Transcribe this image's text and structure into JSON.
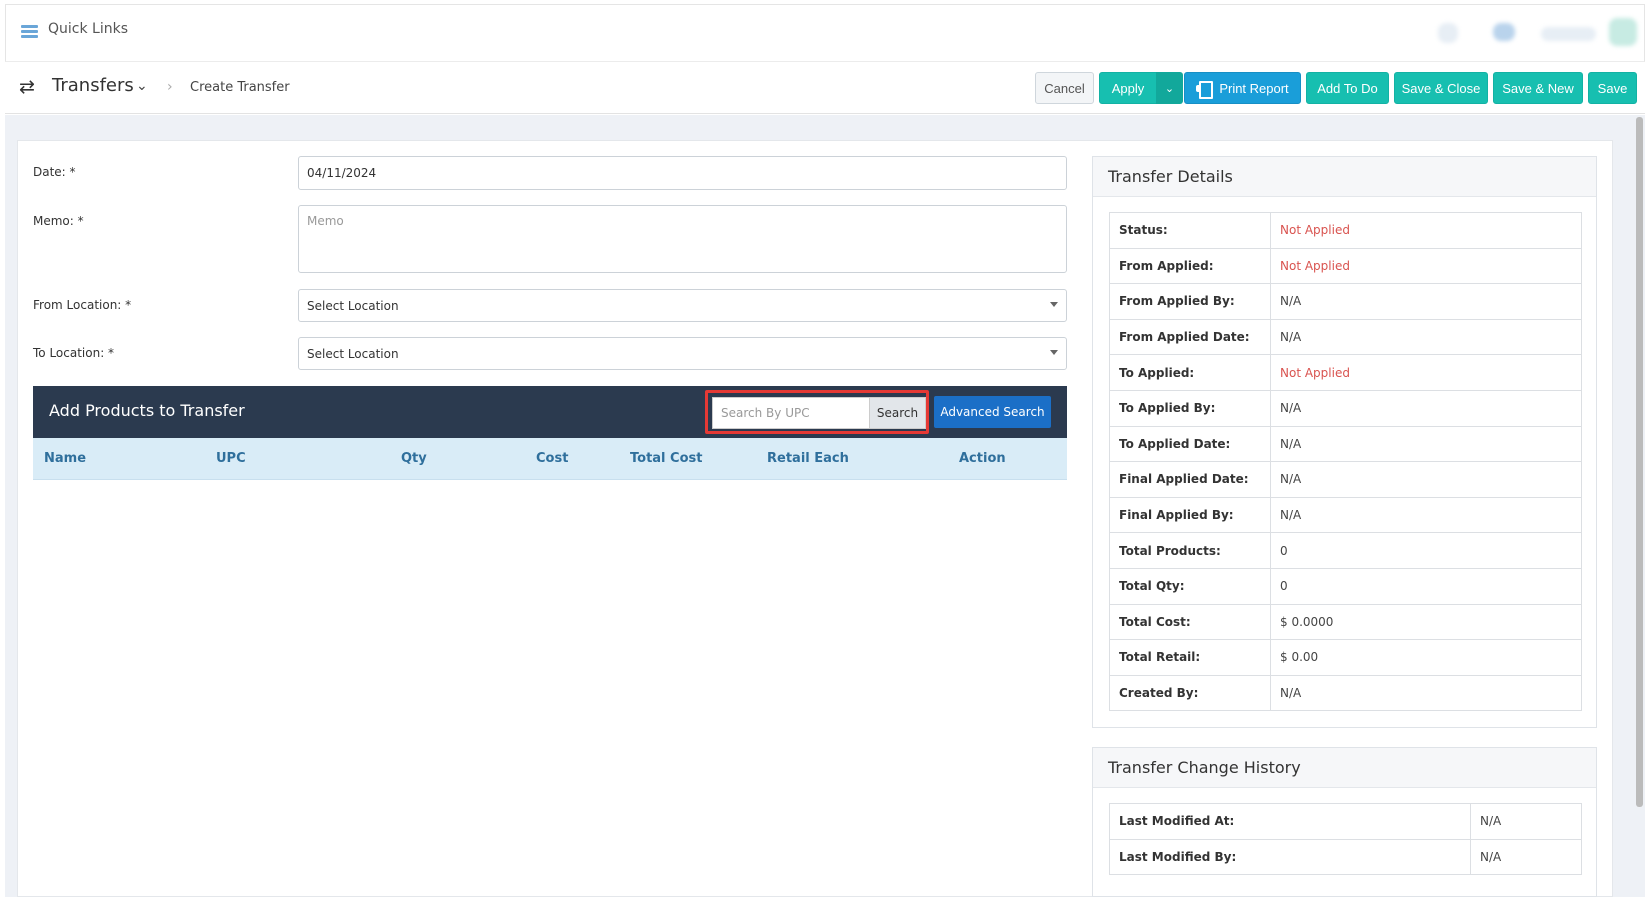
{
  "topbar": {
    "quick_links": "Quick Links"
  },
  "header": {
    "title": "Transfers",
    "breadcrumb": "Create Transfer",
    "buttons": {
      "cancel": "Cancel",
      "apply": "Apply",
      "print_report": "Print Report",
      "add_to_do": "Add To Do",
      "save_close": "Save & Close",
      "save_new": "Save & New",
      "save": "Save"
    }
  },
  "form": {
    "date_label": "Date: *",
    "date_value": "04/11/2024",
    "memo_label": "Memo: *",
    "memo_placeholder": "Memo",
    "from_location_label": "From Location: *",
    "from_location_value": "Select Location",
    "to_location_label": "To Location: *",
    "to_location_value": "Select Location"
  },
  "products": {
    "title": "Add Products to Transfer",
    "search_placeholder": "Search By UPC",
    "search_button": "Search",
    "advanced_search": "Advanced Search",
    "columns": [
      "Name",
      "UPC",
      "Qty",
      "Cost",
      "Total Cost",
      "Retail Each",
      "Action"
    ]
  },
  "transfer_details": {
    "title": "Transfer Details",
    "rows": [
      {
        "label": "Status:",
        "value": "Not Applied"
      },
      {
        "label": "From Applied:",
        "value": "Not Applied"
      },
      {
        "label": "From Applied By:",
        "value": "N/A"
      },
      {
        "label": "From Applied Date:",
        "value": "N/A"
      },
      {
        "label": "To Applied:",
        "value": "Not Applied"
      },
      {
        "label": "To Applied By:",
        "value": "N/A"
      },
      {
        "label": "To Applied Date:",
        "value": "N/A"
      },
      {
        "label": "Final Applied Date:",
        "value": "N/A"
      },
      {
        "label": "Final Applied By:",
        "value": "N/A"
      },
      {
        "label": "Total Products:",
        "value": "0"
      },
      {
        "label": "Total Qty:",
        "value": "0"
      },
      {
        "label": "Total Cost:",
        "value": "$ 0.0000"
      },
      {
        "label": "Total Retail:",
        "value": "$ 0.00"
      },
      {
        "label": "Created By:",
        "value": "N/A"
      }
    ]
  },
  "change_history": {
    "title": "Transfer Change History",
    "rows": [
      {
        "label": "Last Modified At:",
        "value": "N/A"
      },
      {
        "label": "Last Modified By:",
        "value": "N/A"
      }
    ]
  },
  "colors": {
    "accent_teal": "#17bfb0",
    "print_blue": "#1a9ed9",
    "advanced_blue": "#1b6fc7",
    "header_dark": "#2b3a4f",
    "status_red": "#d9534f",
    "highlight_red": "#e53935"
  }
}
